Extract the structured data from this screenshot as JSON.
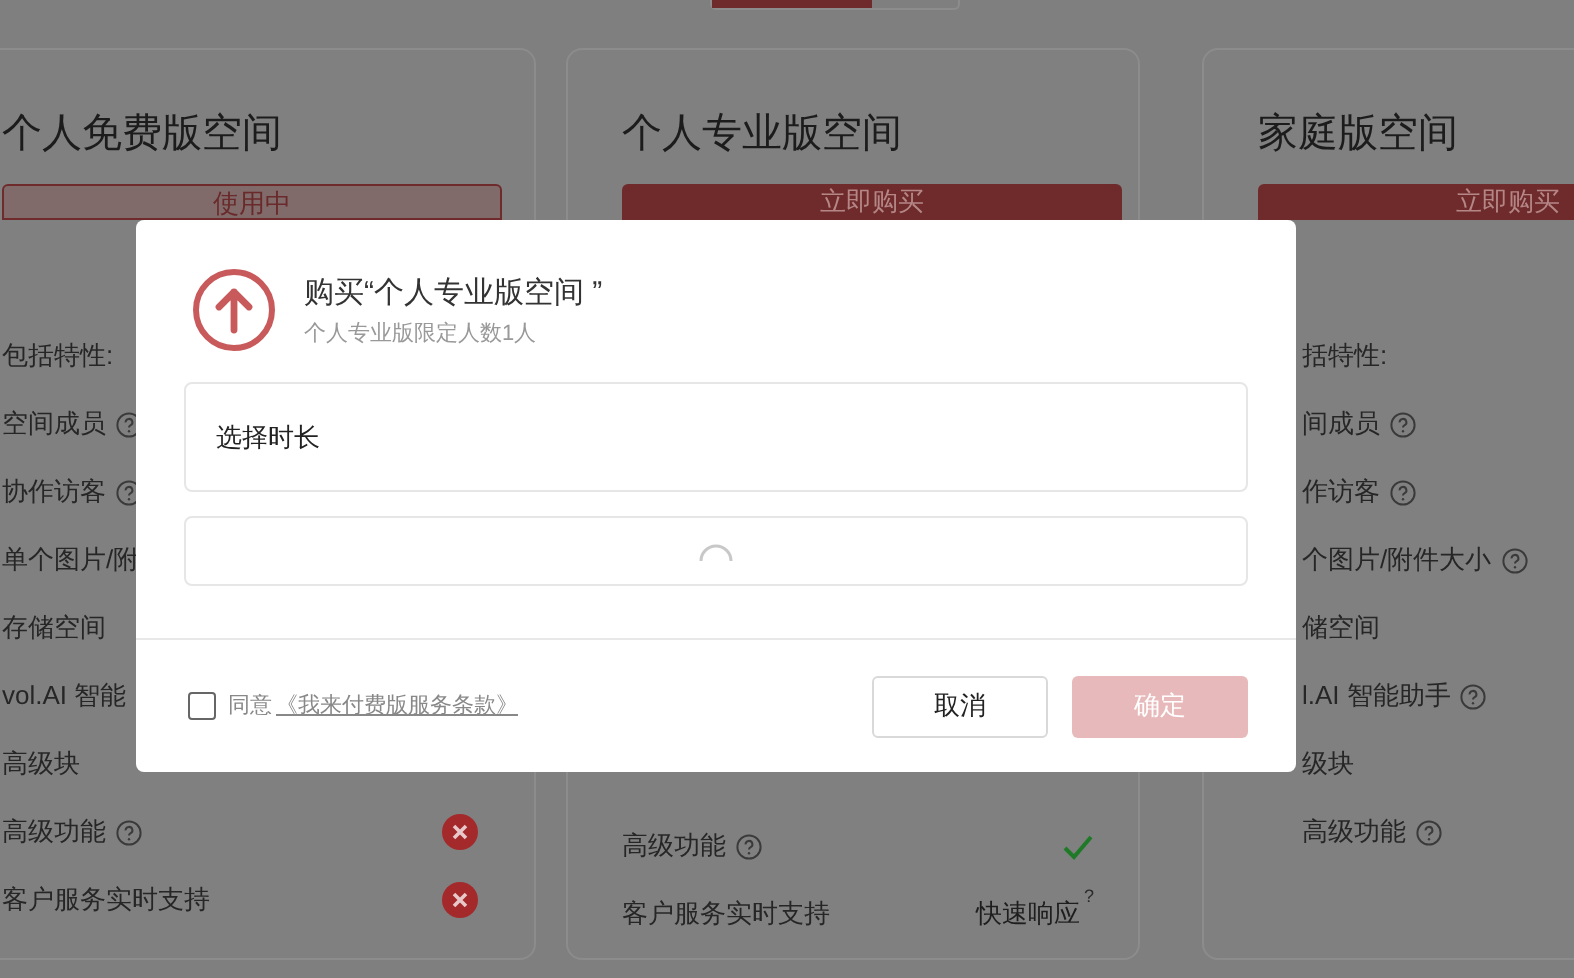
{
  "plan_toggle": {
    "kind": "segmented"
  },
  "cards": [
    {
      "title": "个人免费版空间",
      "button": {
        "label": "使用中",
        "kind": "current"
      },
      "features": [
        {
          "label": "包括特性:",
          "help": false
        },
        {
          "label": "空间成员",
          "help": true
        },
        {
          "label": "协作访客",
          "help": true
        },
        {
          "label": "单个图片/附"
        },
        {
          "label": "存储空间",
          "help": false
        },
        {
          "label": "vol.AI 智能"
        },
        {
          "label": "高级块",
          "help": false
        },
        {
          "label": "高级功能",
          "help": true,
          "status": {
            "kind": "cross"
          }
        },
        {
          "label": "客户服务实时支持",
          "help": false,
          "status": {
            "kind": "cross"
          }
        }
      ]
    },
    {
      "title": "个人专业版空间",
      "button": {
        "label": "立即购买",
        "kind": "buy"
      },
      "features": [
        {
          "label": "高级功能",
          "help": true,
          "status": {
            "kind": "check"
          }
        },
        {
          "label": "客户服务实时支持",
          "help": false,
          "status": {
            "kind": "text",
            "text": "快速响应",
            "note": "?"
          }
        }
      ]
    },
    {
      "title": "家庭版空间",
      "button": {
        "label": "立即购买",
        "kind": "buy"
      },
      "features": [
        {
          "label": "括特性:",
          "help": false
        },
        {
          "label": "间成员",
          "help": true
        },
        {
          "label": "作访客",
          "help": true
        },
        {
          "label": "个图片/附件大小",
          "help": true
        },
        {
          "label": "储空间",
          "help": false
        },
        {
          "label": "l.AI 智能助手",
          "help": true
        },
        {
          "label": "级块",
          "help": false
        },
        {
          "label": "高级功能",
          "help": true
        }
      ]
    }
  ],
  "dialog": {
    "title": "购买“个人专业版空间 ”",
    "subtitle": "个人专业版限定人数1人",
    "duration_label": "选择时长",
    "loading": true,
    "agree": {
      "label": "同意",
      "link": "《我来付费版服务条款》",
      "checked": false
    },
    "buttons": [
      {
        "label": "取消",
        "kind": "secondary",
        "disabled": false
      },
      {
        "label": "确定",
        "kind": "primary",
        "disabled": true
      }
    ]
  }
}
